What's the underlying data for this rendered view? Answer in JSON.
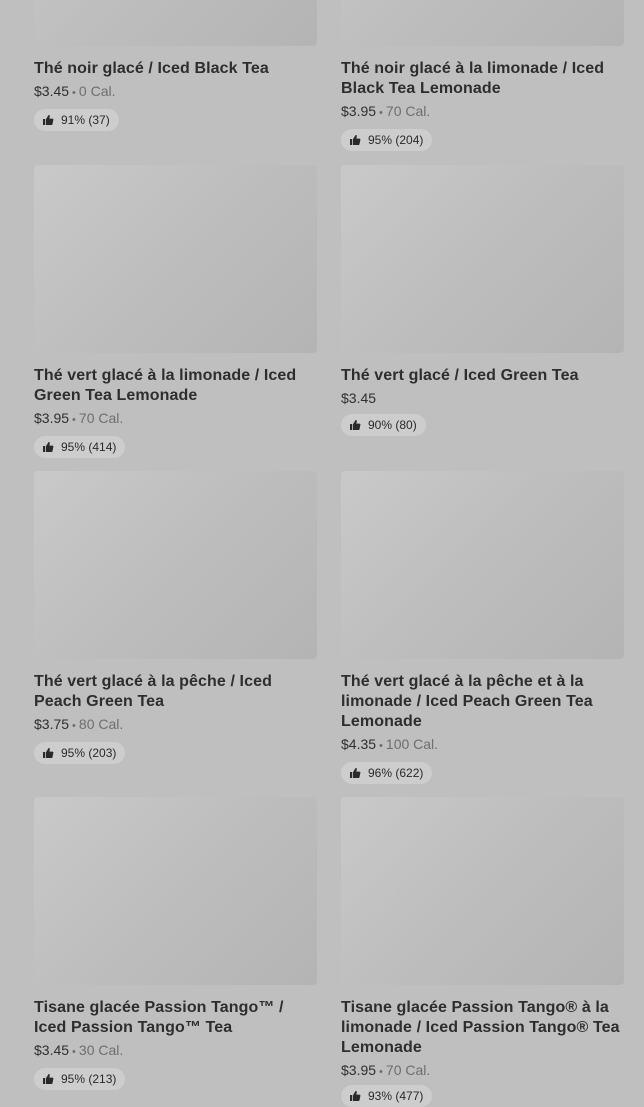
{
  "products": [
    {
      "title": "Thé noir glacé / Iced Black Tea",
      "price": "$3.45",
      "calories": "0 Cal.",
      "rating": "91% (37)"
    },
    {
      "title": "Thé noir glacé à la limonade / Iced Black Tea Lemonade",
      "price": "$3.95",
      "calories": "70 Cal.",
      "rating": "95% (204)"
    },
    {
      "title": "Thé vert glacé à la limonade / Iced Green Tea Lemonade",
      "price": "$3.95",
      "calories": "70 Cal.",
      "rating": "95% (414)"
    },
    {
      "title": "Thé vert glacé / Iced Green Tea",
      "price": "$3.45",
      "calories": "",
      "rating": "90% (80)"
    },
    {
      "title": "Thé vert glacé à la pêche / Iced Peach Green Tea",
      "price": "$3.75",
      "calories": "80 Cal.",
      "rating": "95% (203)"
    },
    {
      "title": "Thé vert glacé à la pêche et à la limonade / Iced Peach Green Tea Lemonade",
      "price": "$4.35",
      "calories": "100 Cal.",
      "rating": "96% (622)"
    },
    {
      "title": "Tisane glacée Passion Tango™ / Iced Passion Tango™ Tea",
      "price": "$3.45",
      "calories": "30 Cal.",
      "rating": "95% (213)"
    },
    {
      "title": "Tisane glacée Passion Tango® à la limonade / Iced Passion Tango® Tea Lemonade",
      "price": "$3.95",
      "calories": "70 Cal.",
      "rating": "93% (477)"
    }
  ],
  "icons": {
    "rating": "thumbs-up-icon"
  }
}
